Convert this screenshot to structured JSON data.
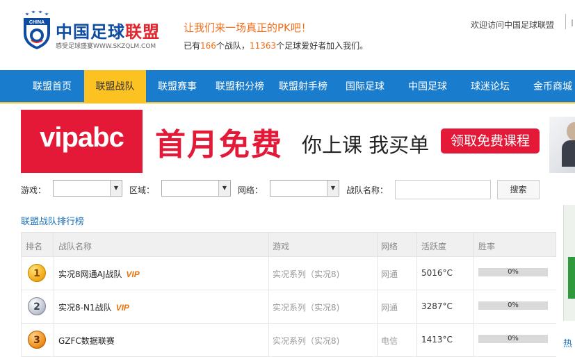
{
  "header": {
    "logo_badge_text": "CHINA",
    "logo_title_part1": "中国足球",
    "logo_title_part2": "联盟",
    "logo_subtitle": "感受足球盛宴WWW.SKZQLM.COM",
    "slogan": "让我们来一场真正的PK吧！",
    "stats_prefix": "已有",
    "team_count": "166",
    "stats_mid": "个战队，",
    "fan_count": "11363",
    "stats_suffix": "个足球爱好者加入我们。",
    "welcome": "欢迎访问中国足球联盟",
    "accent_color": "#f26d1a",
    "logo_icon": "shield-emblem-icon"
  },
  "nav": {
    "items": [
      {
        "label": "联盟首页"
      },
      {
        "label": "联盟战队"
      },
      {
        "label": "联盟赛事"
      },
      {
        "label": "联盟积分榜"
      },
      {
        "label": "联盟射手榜"
      },
      {
        "label": "国际足球"
      },
      {
        "label": "中国足球"
      },
      {
        "label": "球迷论坛"
      },
      {
        "label": "金币商城"
      }
    ],
    "active_index": 1,
    "bg_color": "#1a7ccc",
    "active_color": "#fcc222"
  },
  "banner": {
    "logo": "vipabc",
    "headline": "首月免费",
    "subline": "你上课 我买单",
    "cta": "领取免费课程",
    "brand_color": "#e31937"
  },
  "filters": {
    "game_label": "游戏：",
    "region_label": "区域：",
    "network_label": "网络：",
    "team_name_label": "战队名称：",
    "search_button": "搜索",
    "game_value": "",
    "region_value": "",
    "network_value": "",
    "team_name_value": ""
  },
  "ranking": {
    "title": "联盟战队排行榜",
    "columns": [
      "排名",
      "战队名称",
      "游戏",
      "网络",
      "活跃度",
      "胜率"
    ],
    "rows": [
      {
        "rank": "1",
        "team": "实况8网通AJ战队",
        "vip": "VIP",
        "game": "实况系列（实况8)",
        "network": "网通",
        "activity": "5016°C",
        "winrate": "0%"
      },
      {
        "rank": "2",
        "team": "实况8-N1战队",
        "vip": "VIP",
        "game": "实况系列（实况8)",
        "network": "网通",
        "activity": "3287°C",
        "winrate": "0%"
      },
      {
        "rank": "3",
        "team": "GZFC数据联赛",
        "vip": "",
        "game": "实况系列（实况8)",
        "network": "电信",
        "activity": "1413°C",
        "winrate": "0%"
      }
    ]
  },
  "sidebar": {
    "partial_text": "热"
  }
}
